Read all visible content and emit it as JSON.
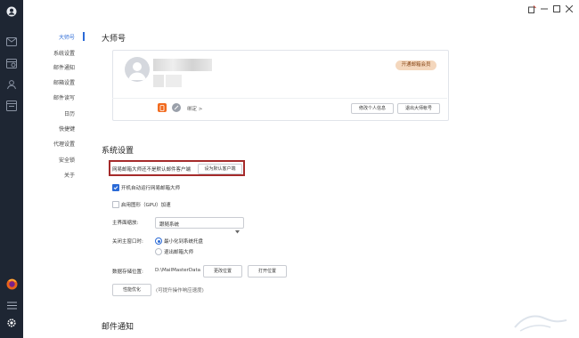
{
  "rail": {
    "icons": [
      "user-icon",
      "mail-icon",
      "calendar-icon",
      "contacts-icon",
      "notes-icon"
    ],
    "bottom_icons": [
      "firefox-icon",
      "menu-icon",
      "settings-icon"
    ]
  },
  "window": {
    "controls": [
      "theme-icon",
      "minimize-icon",
      "maximize-icon",
      "close-icon"
    ]
  },
  "nav": {
    "items": [
      {
        "label": "大师号",
        "active": true
      },
      {
        "label": "系统设置"
      },
      {
        "label": "邮件通知"
      },
      {
        "label": "邮箱设置"
      },
      {
        "label": "邮件读写"
      },
      {
        "label": "日历"
      },
      {
        "label": "快捷键"
      },
      {
        "label": "代理设置"
      },
      {
        "label": "安全锁"
      },
      {
        "label": "关于"
      }
    ]
  },
  "master": {
    "section_title": "大师号",
    "vip_badge": "开通邮箱会员",
    "bind_label": "绑定 >",
    "edit_profile_button": "修改个人信息",
    "logout_button": "退出大师帐号"
  },
  "system": {
    "section_title": "系统设置",
    "default_client_notice": "网易邮箱大师还不是默认邮件客户端",
    "set_default_button": "设为默认客户端",
    "autostart_label": "开机自动运行网易邮箱大师",
    "autostart_checked": true,
    "gpu_label": "启用图形（GPU）加速",
    "gpu_checked": false,
    "zoom_label": "主界面缩放:",
    "zoom_value": "跟随系统",
    "close_label": "关闭主窗口时:",
    "close_options": [
      {
        "label": "最小化到系统托盘",
        "checked": true
      },
      {
        "label": "退出邮箱大师",
        "checked": false
      }
    ],
    "storage_label": "数据存储位置:",
    "storage_path": "D:\\MailMasterData",
    "change_location_button": "更改位置",
    "open_location_button": "打开位置",
    "optimize_button": "性能优化",
    "optimize_hint": "(可提升操作响应速度)"
  },
  "notify": {
    "section_title": "邮件通知"
  },
  "colors": {
    "rail_bg": "#1e2633",
    "accent": "#2b6ad6",
    "highlight": "#a52a2a",
    "vip_bg": "#f4d7bd"
  }
}
